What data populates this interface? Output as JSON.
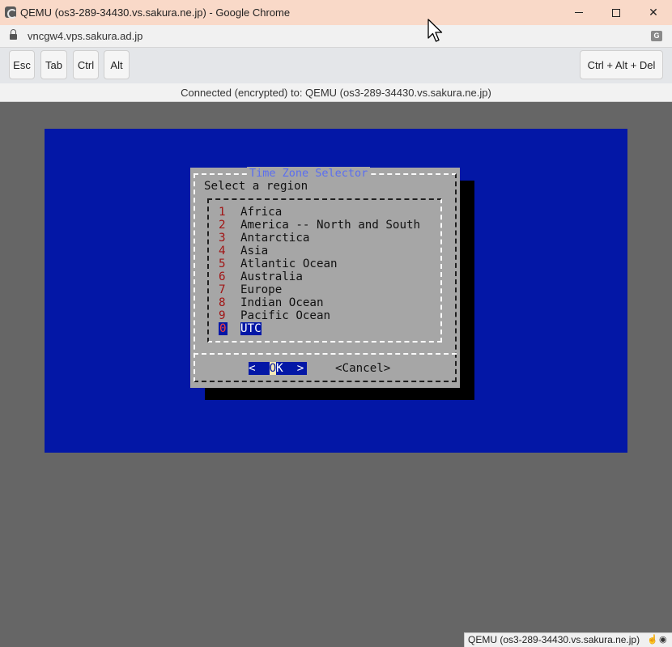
{
  "window": {
    "title": "QEMU (os3-289-34430.vs.sakura.ne.jp) - Google Chrome",
    "controls": {
      "minimize": "minimize",
      "maximize": "maximize",
      "close": "✕"
    }
  },
  "addressbar": {
    "url": "vncgw4.vps.sakura.ad.jp"
  },
  "toolbar": {
    "esc": "Esc",
    "tab": "Tab",
    "ctrl": "Ctrl",
    "alt": "Alt",
    "ctrl_alt_del": "Ctrl + Alt + Del"
  },
  "status": {
    "text": "Connected (encrypted) to: QEMU (os3-289-34430.vs.sakura.ne.jp)"
  },
  "dialog": {
    "title": "Time Zone Selector",
    "prompt": "Select a region",
    "items": [
      {
        "num": "1",
        "label": "Africa"
      },
      {
        "num": "2",
        "label": "America -- North and South"
      },
      {
        "num": "3",
        "label": "Antarctica"
      },
      {
        "num": "4",
        "label": "Asia"
      },
      {
        "num": "5",
        "label": "Atlantic Ocean"
      },
      {
        "num": "6",
        "label": "Australia"
      },
      {
        "num": "7",
        "label": "Europe"
      },
      {
        "num": "8",
        "label": "Indian Ocean"
      },
      {
        "num": "9",
        "label": "Pacific Ocean"
      },
      {
        "num": "0",
        "label": "UTC",
        "selected": true
      }
    ],
    "ok": {
      "left": "<  ",
      "hot": "O",
      "rest": "K  >"
    },
    "cancel": "<Cancel>"
  },
  "tooltip": {
    "text": "QEMU (os3-289-34430.vs.sakura.ne.jp)"
  },
  "colors": {
    "screen": "#0317a6",
    "dialog": "#a6a6a6",
    "title_accent": "#5a6ef0",
    "hotkey": "#a11515",
    "titlebar": "#f9d9c8"
  }
}
